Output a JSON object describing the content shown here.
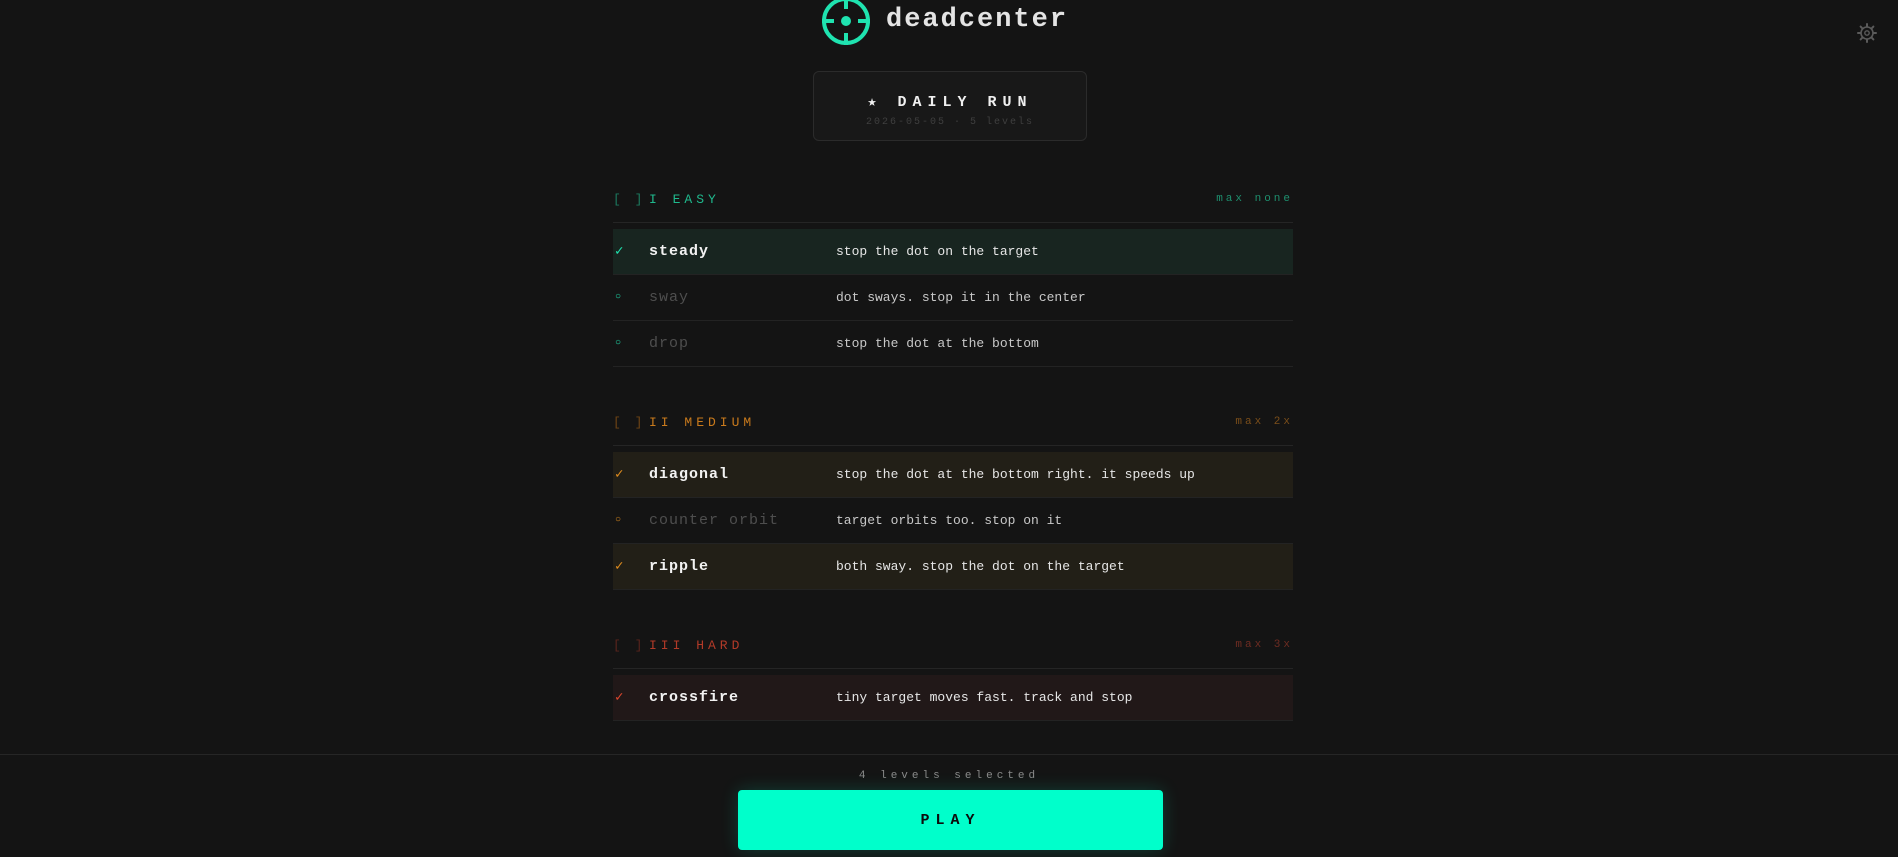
{
  "header": {
    "brand_name": "deadcenter",
    "logo_icon": "crosshair-icon",
    "settings_icon": "gear-icon"
  },
  "daily": {
    "title": "★ DAILY RUN",
    "subtitle": "2026-05-05 · 5 levels"
  },
  "groups": [
    {
      "toggle": "[ ]",
      "name": "I EASY",
      "max": "max none",
      "levels": [
        {
          "mark": "✓",
          "name": "steady",
          "desc": "stop the dot on the target",
          "selected": true
        },
        {
          "mark": "○",
          "name": "sway",
          "desc": "dot sways. stop it in the center",
          "selected": false
        },
        {
          "mark": "○",
          "name": "drop",
          "desc": "stop the dot at the bottom",
          "selected": false
        }
      ]
    },
    {
      "toggle": "[ ]",
      "name": "II MEDIUM",
      "max": "max 2x",
      "levels": [
        {
          "mark": "✓",
          "name": "diagonal",
          "desc": "stop the dot at the bottom right. it speeds up",
          "selected": true
        },
        {
          "mark": "○",
          "name": "counter orbit",
          "desc": "target orbits too. stop on it",
          "selected": false
        },
        {
          "mark": "✓",
          "name": "ripple",
          "desc": "both sway. stop the dot on the target",
          "selected": true
        }
      ]
    },
    {
      "toggle": "[ ]",
      "name": "III HARD",
      "max": "max 3x",
      "levels": [
        {
          "mark": "✓",
          "name": "crossfire",
          "desc": "tiny target moves fast. track and stop",
          "selected": true
        }
      ]
    }
  ],
  "footer": {
    "selected_count": "4 levels selected",
    "play_label": "PLAY"
  },
  "colors": {
    "accent": "#00ffcb",
    "easy": "#1fb98d",
    "medium": "#c97a1c",
    "hard": "#b23a28",
    "background": "#141414"
  }
}
